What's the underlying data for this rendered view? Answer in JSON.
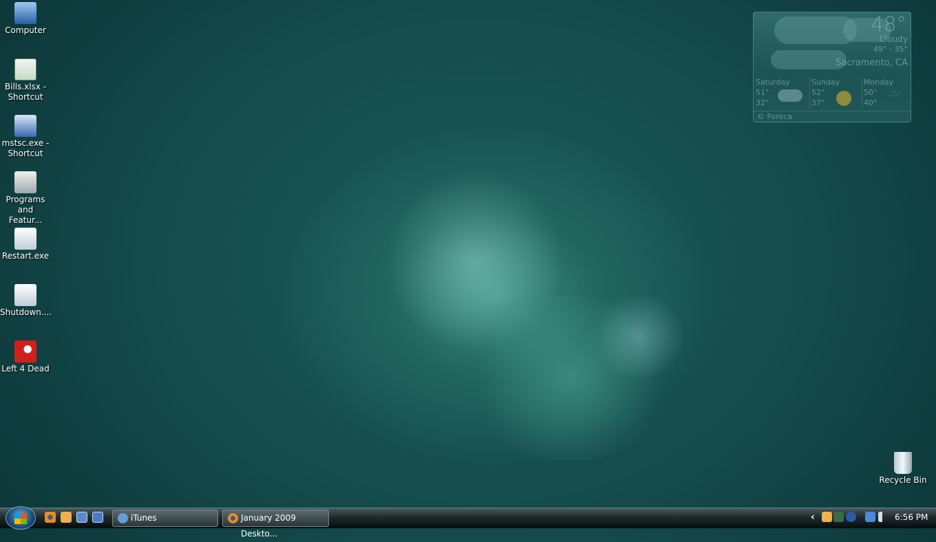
{
  "desktop_icons": [
    {
      "label": "Computer",
      "icon": "computer-icon"
    },
    {
      "label": "Bills.xlsx - Shortcut",
      "icon": "excel-shortcut-icon"
    },
    {
      "label": "mstsc.exe - Shortcut",
      "icon": "remote-desktop-icon"
    },
    {
      "label": "Programs and Featur...",
      "icon": "programs-features-icon"
    },
    {
      "label": "Restart.exe",
      "icon": "exe-shortcut-icon"
    },
    {
      "label": "Shutdown....",
      "icon": "exe-shortcut-icon"
    },
    {
      "label": "Left 4 Dead",
      "icon": "left4dead-icon"
    }
  ],
  "recycle_bin": {
    "label": "Recycle Bin"
  },
  "weather": {
    "temp": "48°",
    "condition": "Cloudy",
    "range": "49° - 35°",
    "location": "Sacramento, CA",
    "forecast": [
      {
        "day": "Saturday",
        "high": "51°",
        "low": "32°",
        "icon": "cloudy"
      },
      {
        "day": "Sunday",
        "high": "52°",
        "low": "37°",
        "icon": "sunny"
      },
      {
        "day": "Monday",
        "high": "50°",
        "low": "40°",
        "icon": "rain"
      }
    ],
    "provider": "© Foreca"
  },
  "taskbar": {
    "buttons": [
      {
        "label": "iTunes"
      },
      {
        "label": "January 2009 Deskto..."
      }
    ],
    "tray_chevron": "‹",
    "clock": "6:56 PM"
  }
}
